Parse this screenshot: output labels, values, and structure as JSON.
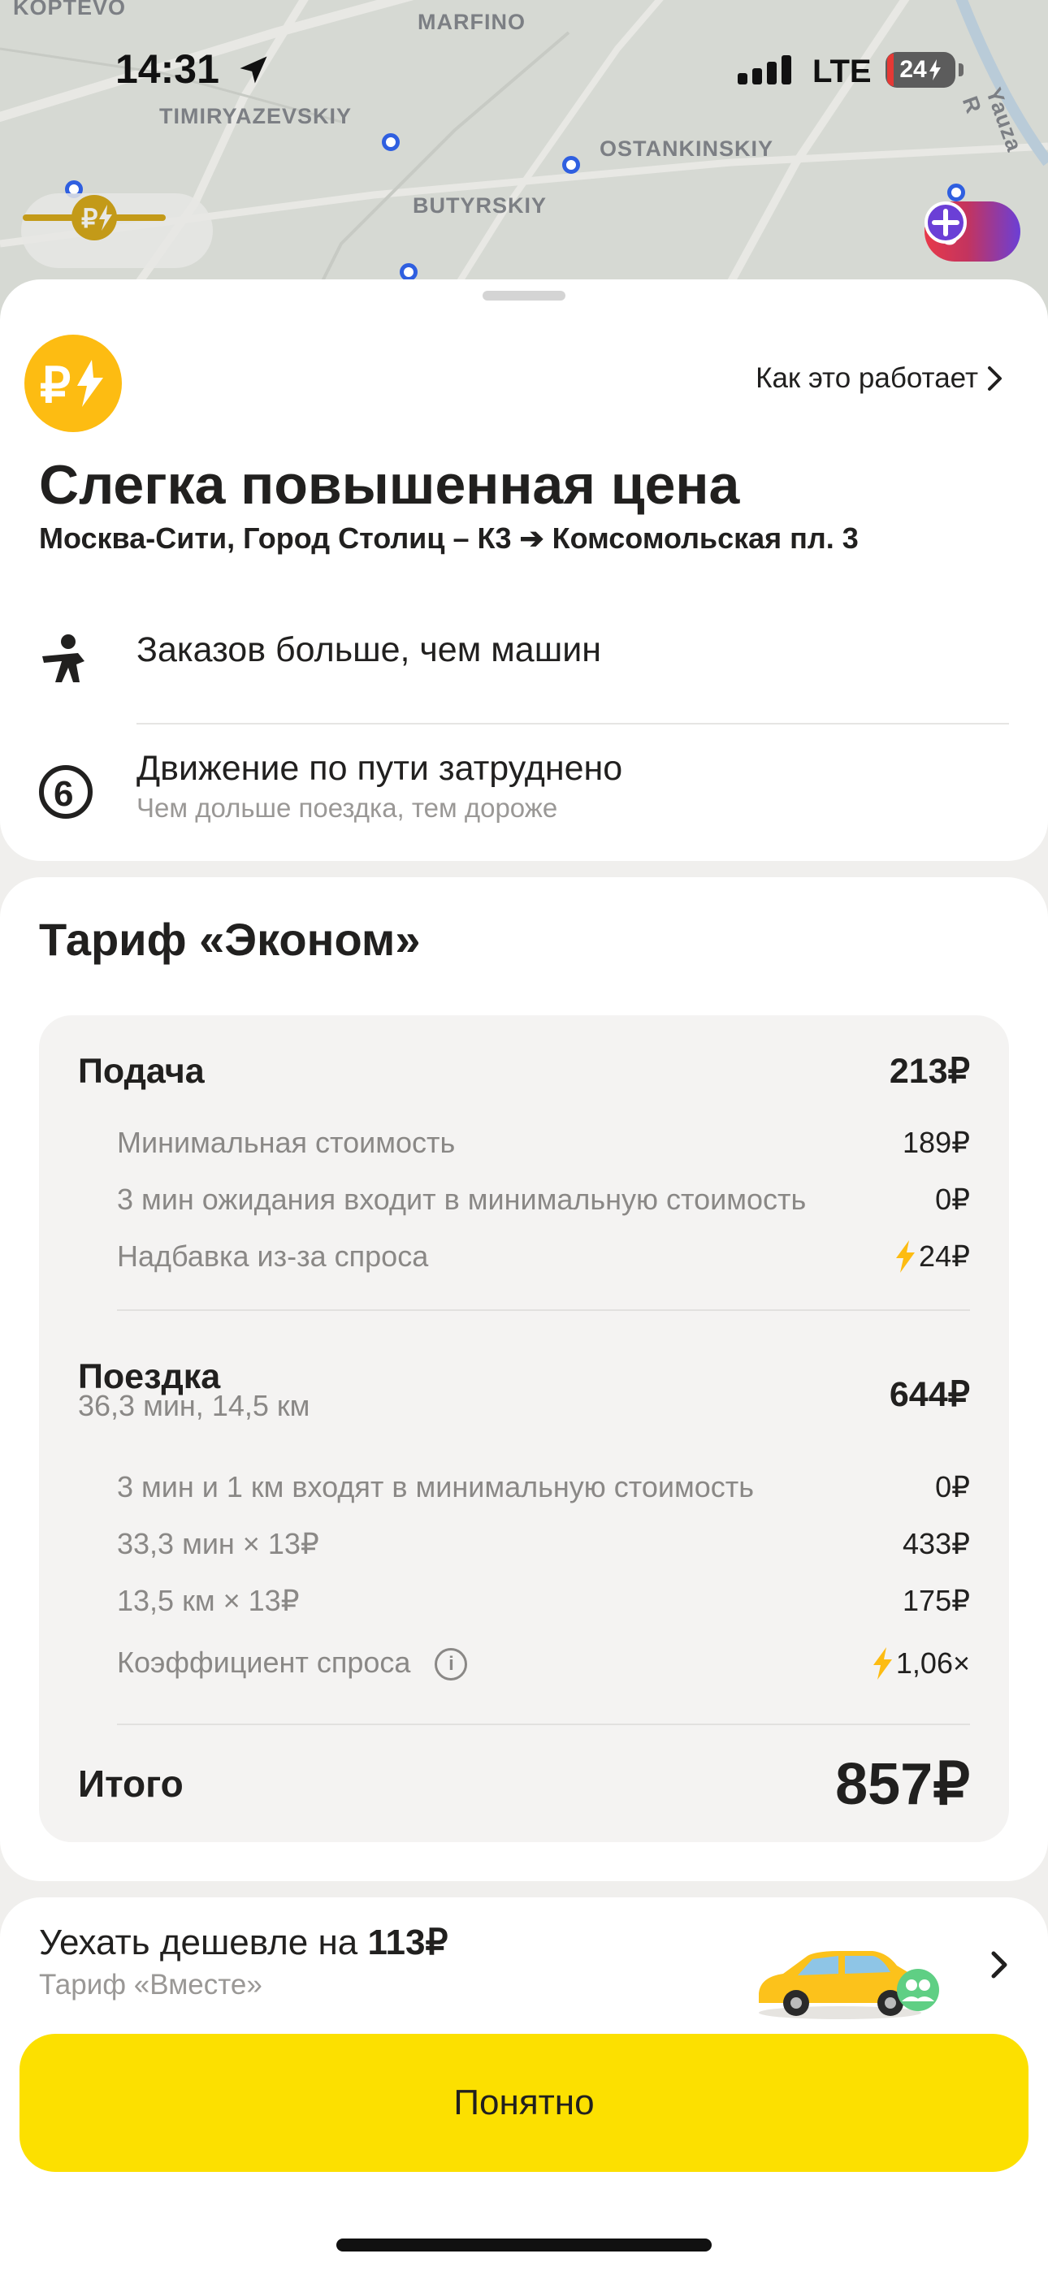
{
  "status_bar": {
    "time": "14:31",
    "network": "LTE",
    "battery": "24"
  },
  "map": {
    "labels": [
      "KOPTEVO",
      "MARFINO",
      "TIMIRYAZEVSKIY",
      "OSTANKINSKIY",
      "BUTYRSKIY",
      "Yauza R"
    ],
    "plus_count": "0"
  },
  "surge": {
    "how_it_works": "Как это работает",
    "title": "Слегка повышенная цена",
    "route": "Москва-Сити, Город Столиц – К3 ➔ Комсомольская пл. 3",
    "reasons": [
      {
        "title": "Заказов больше, чем машин"
      },
      {
        "title": "Движение по пути затруднено",
        "subtitle": "Чем дольше поездка, тем дороже"
      }
    ]
  },
  "tariff": {
    "title": "Тариф «Эконом»",
    "pickup": {
      "label": "Подача",
      "value": "213₽",
      "items": [
        {
          "label": "Минимальная стоимость",
          "value": "189₽"
        },
        {
          "label": "3 мин ожидания входит в минимальную стоимость",
          "value": "0₽"
        },
        {
          "label": "Надбавка из-за спроса",
          "value": "24₽"
        }
      ]
    },
    "ride": {
      "label": "Поездка",
      "meta": "36,3 мин, 14,5 км",
      "value": "644₽",
      "items": [
        {
          "label": "3 мин и 1 км входят в минимальную стоимость",
          "value": "0₽"
        },
        {
          "label": "33,3 мин × 13₽",
          "value": "433₽"
        },
        {
          "label": "13,5 км × 13₽",
          "value": "175₽"
        },
        {
          "label": "Коэффициент спроса",
          "value": "1,06×"
        }
      ]
    },
    "total": {
      "label": "Итого",
      "value": "857₽"
    }
  },
  "cheaper": {
    "prefix": "Уехать дешевле на ",
    "amount": "113₽",
    "subtitle": "Тариф «Вместе»"
  },
  "ok_button": "Понятно",
  "colors": {
    "accent_yellow": "#fce000",
    "surge_orange": "#fdbc12",
    "route_dot_blue": "#2f5fe0"
  }
}
